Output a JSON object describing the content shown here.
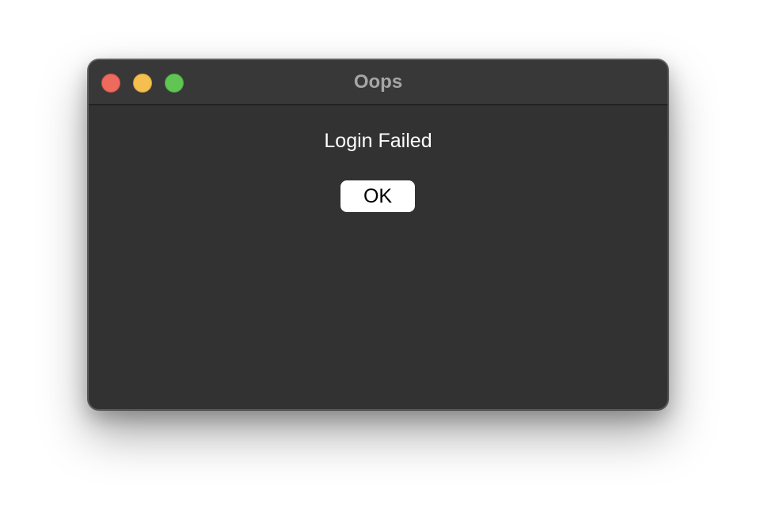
{
  "window": {
    "title": "Oops",
    "traffic_lights": {
      "close_color": "#ec6a5e",
      "minimize_color": "#f4bf4f",
      "zoom_color": "#61c554"
    },
    "background_color": "#323232"
  },
  "dialog": {
    "message": "Login Failed",
    "ok_label": "OK"
  }
}
